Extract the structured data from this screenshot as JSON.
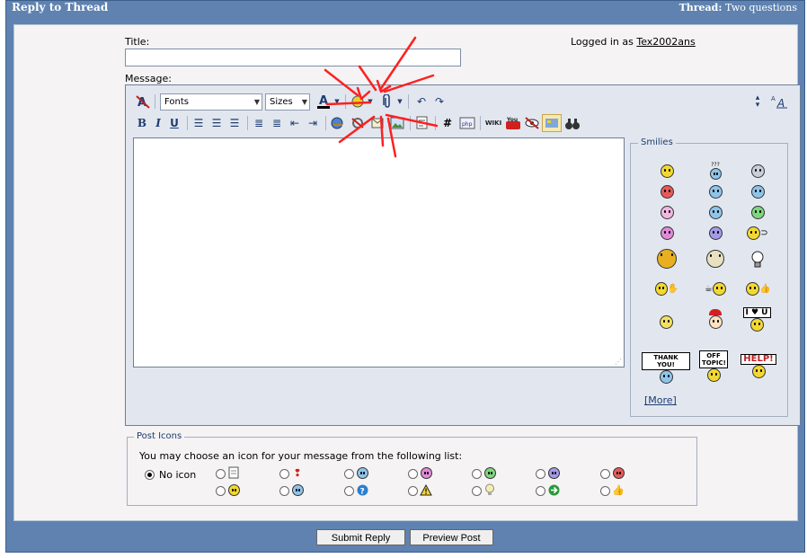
{
  "header": {
    "title": "Reply to Thread",
    "thread_label": "Thread:",
    "thread_name": "Two questions"
  },
  "form": {
    "title_label": "Title:",
    "title_value": "",
    "message_label": "Message:",
    "logged_in_prefix": "Logged in as",
    "logged_in_user": "Tex2002ans"
  },
  "toolbar": {
    "font_select": "Fonts",
    "size_select": "Sizes",
    "bold": "B",
    "italic": "I",
    "underline": "U",
    "hash": "#",
    "wiki": "WIKI",
    "youtube": "You",
    "php": "php"
  },
  "smilies": {
    "legend": "Smilies",
    "more": "[More]",
    "signs": [
      "I ♥ U",
      "THANK YOU!",
      "OFF TOPIC!",
      "HELP!"
    ],
    "confused_mark": "???"
  },
  "post_icons": {
    "legend": "Post Icons",
    "note": "You may choose an icon for your message from the following list:",
    "no_icon_label": "No icon",
    "selected": "no-icon"
  },
  "buttons": {
    "submit": "Submit Reply",
    "preview": "Preview Post"
  },
  "colors": {
    "frame": "#5f82b0",
    "panel": "#f5f3f3",
    "editor": "#e2e7ef",
    "annotation_arrows": "#ff2020"
  }
}
